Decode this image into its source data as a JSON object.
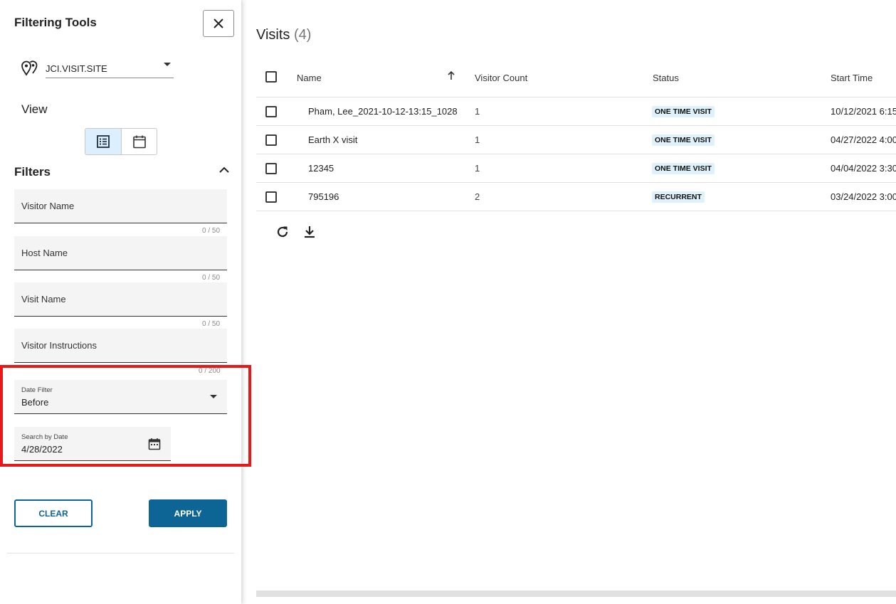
{
  "sidebar": {
    "title": "Filtering Tools",
    "site": "JCI.VISIT.SITE",
    "view_label": "View",
    "filters_title": "Filters",
    "fields": {
      "visitor_name": {
        "placeholder": "Visitor Name",
        "counter": "0 / 50"
      },
      "host_name": {
        "placeholder": "Host Name",
        "counter": "0 / 50"
      },
      "visit_name": {
        "placeholder": "Visit Name",
        "counter": "0 / 50"
      },
      "visitor_instructions": {
        "placeholder": "Visitor Instructions",
        "counter": "0 / 200"
      }
    },
    "date_filter": {
      "label": "Date Filter",
      "value": "Before"
    },
    "search_by_date": {
      "label": "Search by Date",
      "value": "4/28/2022"
    },
    "clear_label": "CLEAR",
    "apply_label": "APPLY"
  },
  "main": {
    "title": "Visits",
    "count": "(4)",
    "columns": {
      "name": "Name",
      "visitor_count": "Visitor Count",
      "status": "Status",
      "start_time": "Start Time"
    },
    "rows": [
      {
        "name": "Pham, Lee_2021-10-12-13:15_1028",
        "count": "1",
        "status": "ONE TIME VISIT",
        "start": "10/12/2021 6:15"
      },
      {
        "name": "Earth X visit",
        "count": "1",
        "status": "ONE TIME VISIT",
        "start": "04/27/2022 4:00"
      },
      {
        "name": "12345",
        "count": "1",
        "status": "ONE TIME VISIT",
        "start": "04/04/2022 3:30"
      },
      {
        "name": "795196",
        "count": "2",
        "status": "RECURRENT",
        "start": "03/24/2022 3:00"
      }
    ]
  },
  "colors": {
    "primary": "#0d6596",
    "badge_bg": "#dff1fb",
    "highlight": "#e81818",
    "active_view_bg": "#dcefff"
  },
  "icons": [
    "close-icon",
    "location-pins-icon",
    "list-view-icon",
    "calendar-view-icon",
    "chevron-up-icon",
    "calendar-icon",
    "sort-arrow-up-icon",
    "refresh-icon",
    "download-icon"
  ]
}
